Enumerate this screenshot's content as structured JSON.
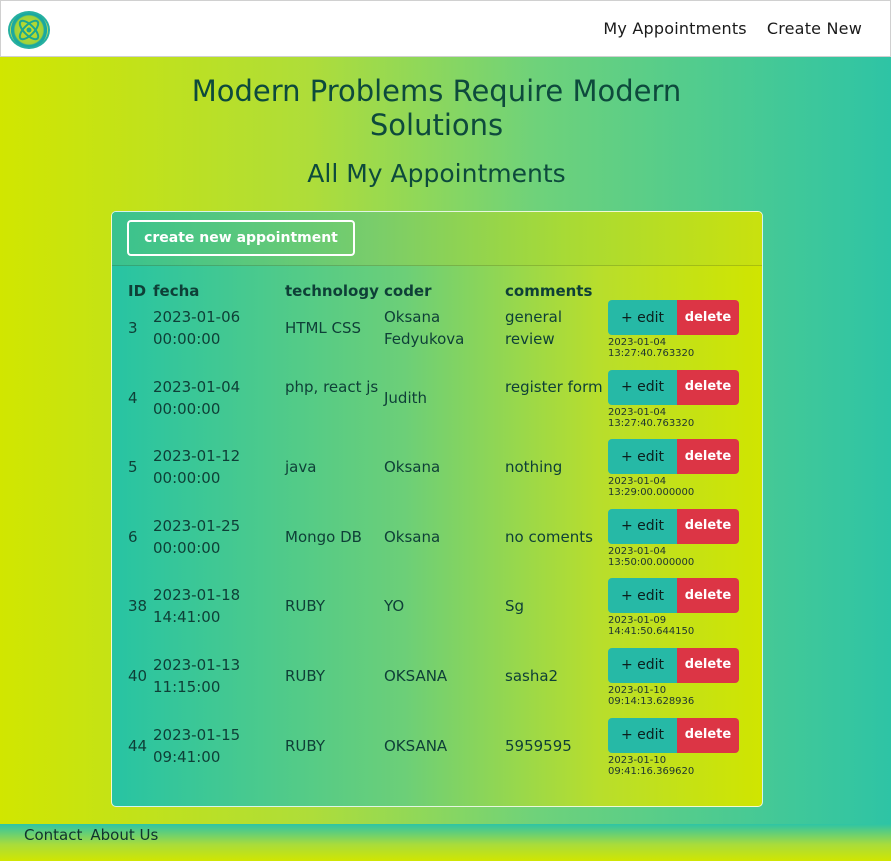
{
  "nav": {
    "logo_icon": "atom-logo-icon",
    "links": [
      "My Appointments",
      "Create New"
    ]
  },
  "header": {
    "title": "Modern Problems Require Modern Solutions",
    "subtitle": "All My Appointments"
  },
  "card": {
    "create_button": "create new appointment"
  },
  "table": {
    "columns": [
      "ID",
      "fecha",
      "technology",
      "coder",
      "comments"
    ],
    "edit_label": "+ edit",
    "delete_label": "delete",
    "rows": [
      {
        "id": "3",
        "fecha": "2023-01-06 00:00:00",
        "technology": "HTML CSS",
        "coder": "Oksana Fedyukova",
        "comments": "general review",
        "stamp": "2023-01-04 13:27:40.763320"
      },
      {
        "id": "4",
        "fecha": "2023-01-04 00:00:00",
        "technology": "php, react js",
        "coder": "Judith",
        "comments": "register form",
        "stamp": "2023-01-04 13:27:40.763320"
      },
      {
        "id": "5",
        "fecha": "2023-01-12 00:00:00",
        "technology": "java",
        "coder": "Oksana",
        "comments": "nothing",
        "stamp": "2023-01-04 13:29:00.000000"
      },
      {
        "id": "6",
        "fecha": "2023-01-25 00:00:00",
        "technology": "Mongo DB",
        "coder": "Oksana",
        "comments": "no coments",
        "stamp": "2023-01-04 13:50:00.000000"
      },
      {
        "id": "38",
        "fecha": "2023-01-18 14:41:00",
        "technology": "RUBY",
        "coder": "YO",
        "comments": "Sg",
        "stamp": "2023-01-09 14:41:50.644150"
      },
      {
        "id": "40",
        "fecha": "2023-01-13 11:15:00",
        "technology": "RUBY",
        "coder": "OKSANA",
        "comments": "sasha2",
        "stamp": "2023-01-10 09:14:13.628936"
      },
      {
        "id": "44",
        "fecha": "2023-01-15 09:41:00",
        "technology": "RUBY",
        "coder": "OKSANA",
        "comments": "5959595",
        "stamp": "2023-01-10 09:41:16.369620"
      }
    ]
  },
  "footer": {
    "links": [
      "Contact",
      "About Us"
    ]
  }
}
